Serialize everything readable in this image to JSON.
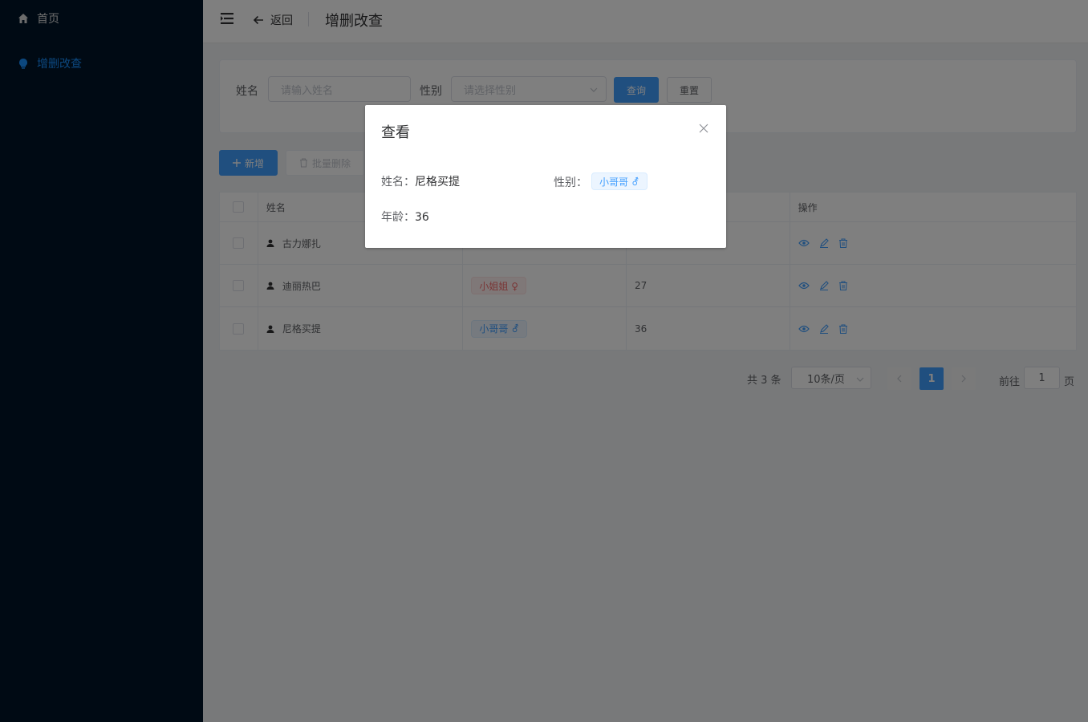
{
  "sidebar": {
    "items": [
      {
        "label": "首页",
        "icon": "home-icon"
      },
      {
        "label": "增删改查",
        "icon": "lightbulb-icon",
        "active": true
      }
    ]
  },
  "header": {
    "back_label": "返回",
    "title": "增删改查"
  },
  "search": {
    "name_label": "姓名",
    "name_placeholder": "请输入姓名",
    "gender_label": "性别",
    "gender_placeholder": "请选择性别",
    "query_label": "查询",
    "reset_label": "重置"
  },
  "toolbar": {
    "add_label": "新增",
    "batch_delete_label": "批量删除"
  },
  "table": {
    "headers": {
      "name": "姓名",
      "actions": "操作"
    },
    "rows": [
      {
        "name": "古力娜扎",
        "gender": "",
        "age": ""
      },
      {
        "name": "迪丽热巴",
        "gender": "小姐姐 ♀",
        "age": "27"
      },
      {
        "name": "尼格买提",
        "gender": "小哥哥 ⚦",
        "age": "36"
      }
    ]
  },
  "pagination": {
    "total": "共 3 条",
    "page_size": "10条/页",
    "current": "1",
    "goto_label": "前往",
    "goto_value": "1",
    "page_suffix": "页"
  },
  "dialog": {
    "title": "查看",
    "name_label": "姓名：",
    "name_value": "尼格买提",
    "gender_label": "性别：",
    "gender_value": "小哥哥 ⚦",
    "age_label": "年龄：",
    "age_value": "36"
  },
  "colors": {
    "sidebar_bg": "#001529",
    "primary": "#409eff",
    "active_menu": "#1890ff",
    "tag_blue": "#409eff",
    "tag_red": "#f56c6c"
  }
}
